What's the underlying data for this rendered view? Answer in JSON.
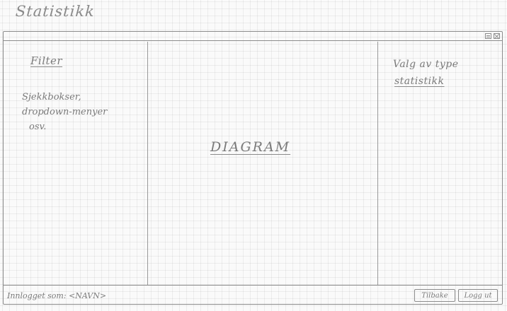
{
  "page": {
    "title": "Statistikk"
  },
  "filter": {
    "heading": "Filter",
    "note_lines": [
      "Sjekkbokser,",
      "dropdown-menyer",
      "osv."
    ]
  },
  "main": {
    "diagram_label": "DIAGRAM"
  },
  "stat_type": {
    "label": "Valg av type",
    "link": "statistikk"
  },
  "footer": {
    "logged_in": "Innlogget som: <NAVN>",
    "back_label": "Tilbake",
    "logout_label": "Logg ut"
  },
  "icons": {
    "minimize": "minimize-icon",
    "close": "close-icon"
  }
}
